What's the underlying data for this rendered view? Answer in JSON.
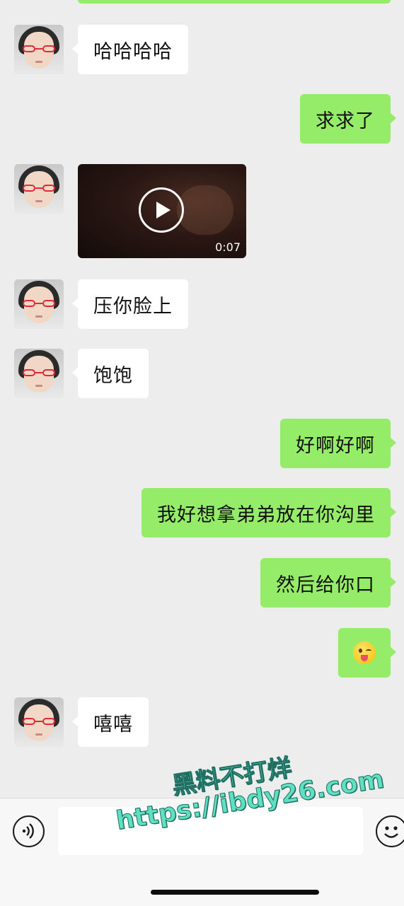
{
  "messages": [
    {
      "side": "in",
      "text": "哈哈哈哈"
    },
    {
      "side": "out",
      "text": "求求了"
    },
    {
      "side": "in",
      "type": "video",
      "duration": "0:07"
    },
    {
      "side": "in",
      "text": "压你脸上"
    },
    {
      "side": "in",
      "text": "饱饱"
    },
    {
      "side": "out",
      "text": "好啊好啊"
    },
    {
      "side": "out",
      "text": "我好想拿弟弟放在你沟里"
    },
    {
      "side": "out",
      "text": "然后给你口"
    },
    {
      "side": "out",
      "type": "emoji",
      "emoji": "winking-face-with-tongue"
    },
    {
      "side": "in",
      "text": "嘻嘻"
    }
  ],
  "input_bar": {
    "voice_icon": "voice-icon",
    "emoji_icon": "smiley-icon",
    "input_value": ""
  },
  "watermark": {
    "line1": "黑料不打烊",
    "line2": "https://ibdy26.com"
  },
  "colors": {
    "background": "#ededed",
    "outgoing_bubble": "#95ec69",
    "incoming_bubble": "#ffffff",
    "watermark": "#5fe0c2"
  }
}
